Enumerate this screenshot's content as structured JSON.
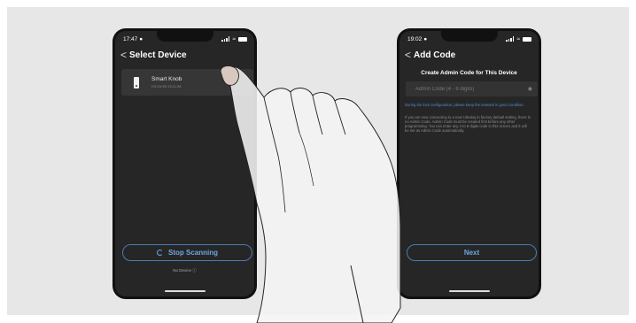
{
  "left_phone": {
    "status": {
      "time": "17:47"
    },
    "nav": {
      "back": "<",
      "title": "Select Device"
    },
    "device": {
      "name": "Smart Knob",
      "id": "D9:2A:9E:15:11:98"
    },
    "scan_button_label": "Stop Scanning",
    "no_device_label": "No Device",
    "no_device_icon": "question-circle-icon"
  },
  "right_phone": {
    "status": {
      "time": "19:02"
    },
    "nav": {
      "back": "<",
      "title": "Add Code"
    },
    "section_title": "Create Admin Code for This Device",
    "admin_code_input": {
      "value": "",
      "placeholder": "Admin Code (4 - 8 digits)"
    },
    "note_blue": "During the lock configuration, please keep the network in good condition.",
    "note_grey": "If you are now connecting to a new Ultraloq in factory default setting, there is no Admin Code. Admin Code must be created first before any other programming. You can enter any 4 to 8 digits code in this screen and it will be set as Admin Code automatically.",
    "next_button_label": "Next"
  },
  "colors": {
    "background": "#e7e7e7",
    "screen": "#262626",
    "accent": "#6ea6e0",
    "note_blue": "#4e8ed0"
  }
}
